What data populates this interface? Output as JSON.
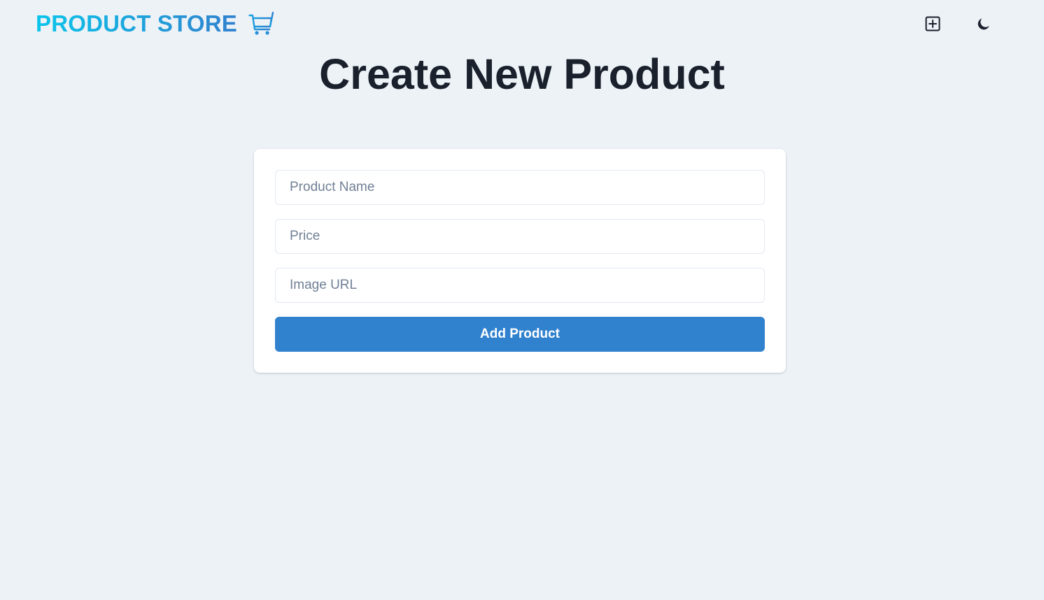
{
  "navbar": {
    "brand_label": "PRODUCT STORE",
    "brand_icon": "shopping-cart-icon",
    "create_button_icon": "plus-square-icon",
    "theme_toggle_icon": "moon-icon"
  },
  "page": {
    "title": "Create New Product"
  },
  "form": {
    "name_value": "",
    "name_placeholder": "Product Name",
    "price_value": "",
    "price_placeholder": "Price",
    "image_value": "",
    "image_placeholder": "Image URL",
    "submit_label": "Add Product"
  },
  "colors": {
    "background": "#edf2f7",
    "brand_gradient_start": "#0bc5ea",
    "brand_gradient_end": "#3182ce",
    "accent": "#3182ce",
    "title_text": "#1a202c",
    "placeholder_text": "#718096"
  }
}
